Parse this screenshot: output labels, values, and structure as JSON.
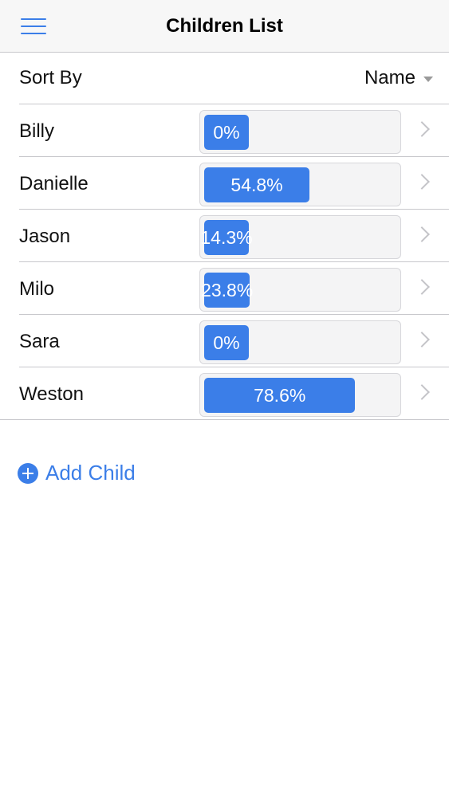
{
  "navbar": {
    "title": "Children List",
    "menu_icon": "hamburger-menu-icon"
  },
  "sort": {
    "label": "Sort By",
    "selected": "Name"
  },
  "children": [
    {
      "name": "Billy",
      "progress_label": "0%",
      "progress": 0
    },
    {
      "name": "Danielle",
      "progress_label": "54.8%",
      "progress": 54.8
    },
    {
      "name": "Jason",
      "progress_label": "14.3%",
      "progress": 14.3
    },
    {
      "name": "Milo",
      "progress_label": "23.8%",
      "progress": 23.8
    },
    {
      "name": "Sara",
      "progress_label": "0%",
      "progress": 0
    },
    {
      "name": "Weston",
      "progress_label": "78.6%",
      "progress": 78.6
    }
  ],
  "add_child": {
    "label": "Add Child",
    "icon": "plus-circle-icon"
  },
  "colors": {
    "accent": "#3b7ee8",
    "separator": "#c8c8cc",
    "navbar_bg": "#f7f7f7",
    "track_bg": "#f4f4f5"
  }
}
